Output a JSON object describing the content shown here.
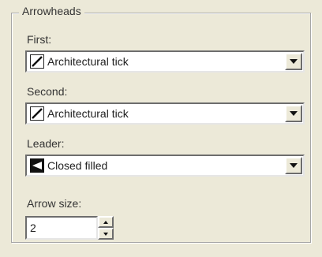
{
  "group": {
    "title": "Arrowheads"
  },
  "first": {
    "label": "First:",
    "value": "Architectural tick",
    "icon": "architectural-tick-icon"
  },
  "second": {
    "label": "Second:",
    "value": "Architectural tick",
    "icon": "architectural-tick-icon"
  },
  "leader": {
    "label": "Leader:",
    "value": "Closed filled",
    "icon": "closed-filled-icon"
  },
  "arrow_size": {
    "label": "Arrow size:",
    "value": "2"
  }
}
